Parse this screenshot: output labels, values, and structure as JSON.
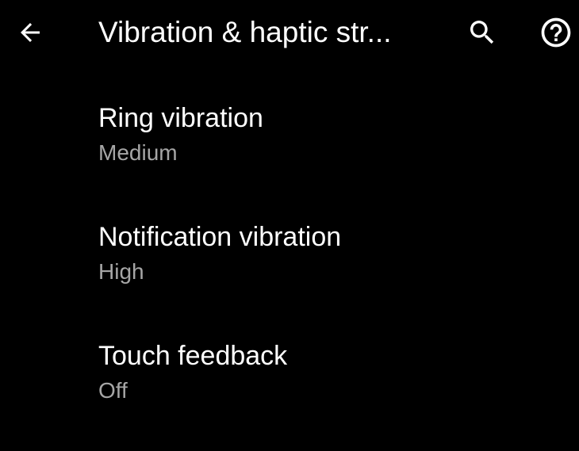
{
  "colors": {
    "background": "#000000",
    "primary_text": "#ffffff",
    "secondary_text": "#a6a6a6"
  },
  "app_bar": {
    "title": "Vibration & haptic str...",
    "back_icon": "arrow-back-icon",
    "search_icon": "search-icon",
    "help_icon": "help-circle-icon"
  },
  "preferences": [
    {
      "title": "Ring vibration",
      "summary": "Medium"
    },
    {
      "title": "Notification vibration",
      "summary": "High"
    },
    {
      "title": "Touch feedback",
      "summary": "Off"
    }
  ]
}
